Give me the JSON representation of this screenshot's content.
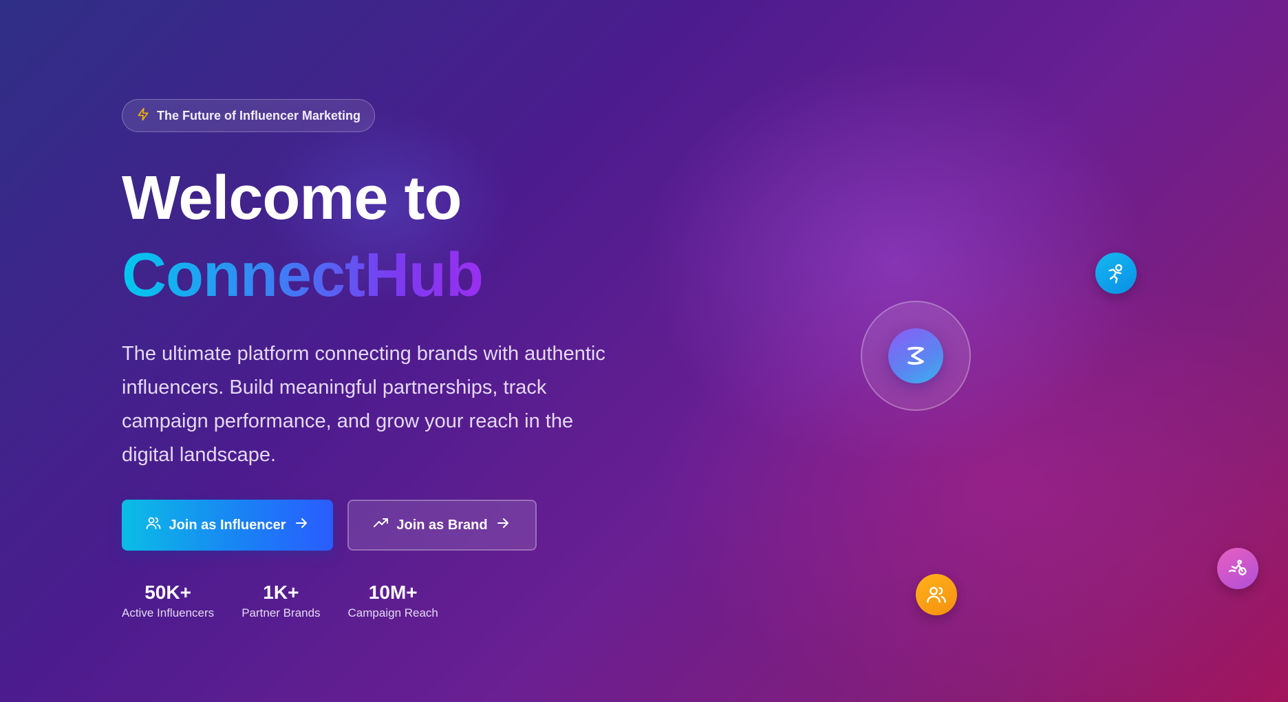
{
  "badge": {
    "icon": "lightning-bolt-icon",
    "text": "The Future of Influencer Marketing",
    "icon_color": "#f5b400"
  },
  "headline": {
    "line1": "Welcome to",
    "line2": "ConnectHub"
  },
  "description": "The ultimate platform connecting brands with authentic influencers. Build meaningful partnerships, track campaign performance, and grow your reach in the digital landscape.",
  "buttons": {
    "influencer": {
      "label": "Join as Influencer",
      "icon": "users-icon",
      "trail_icon": "arrow-right-icon"
    },
    "brand": {
      "label": "Join as Brand",
      "icon": "trending-up-icon",
      "trail_icon": "arrow-right-icon"
    }
  },
  "stats": [
    {
      "value": "50K+",
      "label": "Active Influencers"
    },
    {
      "value": "1K+",
      "label": "Partner Brands"
    },
    {
      "value": "10M+",
      "label": "Campaign Reach"
    }
  ],
  "decor": {
    "center_orb_icon": "zap-icon",
    "floating_icons": [
      "running-person-icon",
      "users-icon",
      "bicycle-icon"
    ]
  },
  "colors": {
    "accent_cyan": "#00c9ee",
    "accent_purple": "#9a2ff0",
    "primary_button": "#1a7ff5",
    "orange_badge": "#f5900f",
    "pink_badge": "#e85fc0"
  }
}
